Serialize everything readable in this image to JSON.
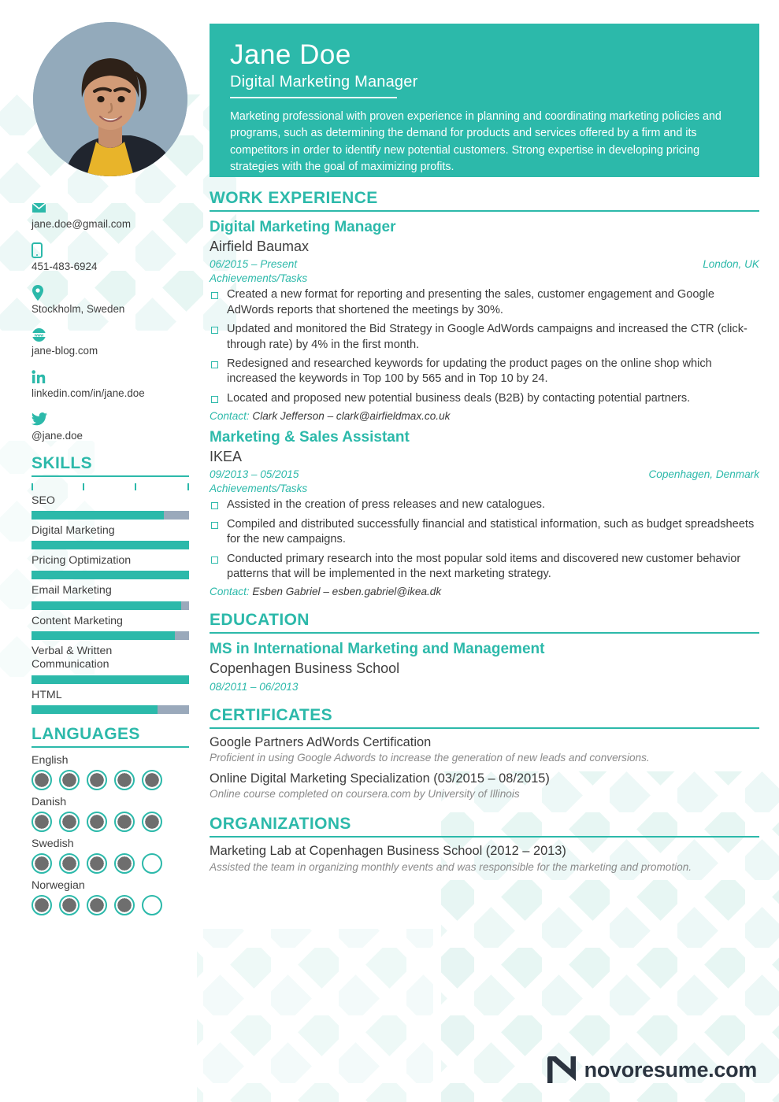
{
  "theme": {
    "accent": "#2cb9aa",
    "bar_track": "#9aa9bb",
    "dot_fill": "#6e6e6e",
    "text": "#3a3a3a",
    "muted": "#8a8a8a",
    "logo": "#2b3440",
    "header_band": "#2cb9aa",
    "photo_bg": "#8fa7b8"
  },
  "header": {
    "name": "Jane Doe",
    "job_title": "Digital Marketing Manager",
    "summary": "Marketing professional with proven experience in planning and coordinating marketing policies and programs, such as determining the demand for products and services offered by a firm and its competitors in order to identify new potential customers. Strong expertise in developing pricing strategies with the goal of maximizing profits.",
    "photo_alt": "profile-photo"
  },
  "contact": [
    {
      "icon": "envelope-icon",
      "value": "jane.doe@gmail.com"
    },
    {
      "icon": "phone-icon",
      "value": "451-483-6924"
    },
    {
      "icon": "location-pin-icon",
      "value": "Stockholm, Sweden"
    },
    {
      "icon": "www-globe-icon",
      "value": "jane-blog.com"
    },
    {
      "icon": "linkedin-icon",
      "value": "linkedin.com/in/jane.doe"
    },
    {
      "icon": "twitter-icon",
      "value": "@jane.doe"
    }
  ],
  "skills": {
    "heading": "SKILLS",
    "items": [
      {
        "label": "SEO",
        "level": 84
      },
      {
        "label": "Digital Marketing",
        "level": 100
      },
      {
        "label": "Pricing Optimization",
        "level": 100
      },
      {
        "label": "Email Marketing",
        "level": 95
      },
      {
        "label": "Content Marketing",
        "level": 91
      },
      {
        "label": "Verbal & Written Communication",
        "level": 100
      },
      {
        "label": "HTML",
        "level": 80
      }
    ]
  },
  "languages": {
    "heading": "LANGUAGES",
    "max": 5,
    "items": [
      {
        "label": "English",
        "level": 5
      },
      {
        "label": "Danish",
        "level": 5
      },
      {
        "label": "Swedish",
        "level": 4
      },
      {
        "label": "Norwegian",
        "level": 4
      }
    ]
  },
  "work": {
    "heading": "WORK EXPERIENCE",
    "entries": [
      {
        "title": "Digital Marketing Manager",
        "org": "Airfield Baumax",
        "dates": "06/2015 – Present",
        "location": "London, UK",
        "achievements_label": "Achievements/Tasks",
        "bullets": [
          "Created a new format for reporting and presenting the sales, customer engagement and Google AdWords reports that shortened the meetings by 30%.",
          "Updated and monitored the Bid Strategy in Google AdWords campaigns and increased the CTR (click-through rate) by 4% in the first month.",
          "Redesigned and researched keywords for updating the product pages on the online shop which increased the keywords in Top 100 by 565 and in Top 10 by 24.",
          "Located and proposed new potential business deals (B2B) by contacting potential partners."
        ],
        "contact_label": "Contact:",
        "contact_value": "Clark Jefferson – clark@airfieldmax.co.uk"
      },
      {
        "title": "Marketing & Sales Assistant",
        "org": "IKEA",
        "dates": "09/2013 – 05/2015",
        "location": "Copenhagen, Denmark",
        "achievements_label": "Achievements/Tasks",
        "bullets": [
          "Assisted in the creation of press releases and new catalogues.",
          "Compiled and distributed successfully financial and statistical information, such as budget spreadsheets for the new campaigns.",
          "Conducted primary research into the most popular sold items and discovered new customer behavior patterns that will be implemented in the next marketing strategy."
        ],
        "contact_label": "Contact:",
        "contact_value": "Esben Gabriel – esben.gabriel@ikea.dk"
      }
    ]
  },
  "education": {
    "heading": "EDUCATION",
    "entries": [
      {
        "title": "MS in International Marketing and Management",
        "org": "Copenhagen Business School",
        "dates": "08/2011 – 06/2013"
      }
    ]
  },
  "certificates": {
    "heading": "CERTIFICATES",
    "items": [
      {
        "title": "Google Partners AdWords Certification",
        "desc": "Proficient in using Google Adwords to increase the generation of new leads and conversions."
      },
      {
        "title": "Online Digital Marketing Specialization (03/2015 – 08/2015)",
        "desc": "Online course completed on coursera.com by University of Illinois"
      }
    ]
  },
  "organizations": {
    "heading": "ORGANIZATIONS",
    "items": [
      {
        "title": "Marketing Lab at Copenhagen Business School (2012 – 2013)",
        "desc": "Assisted the team in organizing monthly events and was responsible for the marketing and promotion."
      }
    ]
  },
  "footer": {
    "logo_text": "novoresume.com",
    "logo_mark": "novoresume-n-logo"
  }
}
